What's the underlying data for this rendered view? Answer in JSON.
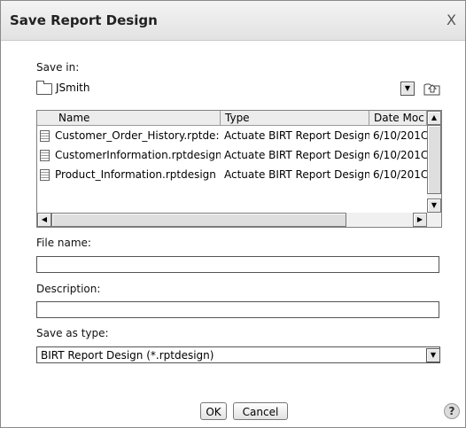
{
  "dialog": {
    "title": "Save Report Design",
    "close_glyph": "X"
  },
  "save_in": {
    "label": "Save in:",
    "folder": "JSmith"
  },
  "file_list": {
    "columns": [
      "Name",
      "Type",
      "Date Moc"
    ],
    "rows": [
      {
        "name": "Customer_Order_History.rptde:",
        "type": "Actuate BIRT Report Design",
        "date": "6/10/201C"
      },
      {
        "name": "CustomerInformation.rptdesign",
        "type": "Actuate BIRT Report Design",
        "date": "6/10/201C"
      },
      {
        "name": "Product_Information.rptdesign",
        "type": "Actuate BIRT Report Design",
        "date": "6/10/201C"
      }
    ]
  },
  "file_name": {
    "label": "File name:",
    "value": ""
  },
  "description": {
    "label": "Description:",
    "value": ""
  },
  "save_as_type": {
    "label": "Save as type:",
    "value": "BIRT Report Design (*.rptdesign)"
  },
  "buttons": {
    "ok": "OK",
    "cancel": "Cancel",
    "help": "?"
  },
  "icons": {
    "folder": "folder-icon",
    "up_folder": "up-folder-icon",
    "file": "report-file-icon",
    "help": "help-icon"
  }
}
